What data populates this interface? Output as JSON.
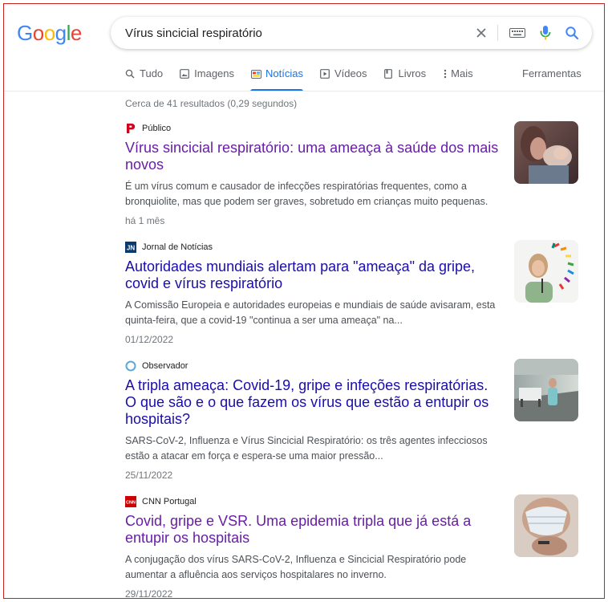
{
  "logo": {
    "letters": [
      "G",
      "o",
      "o",
      "g",
      "l",
      "e"
    ]
  },
  "search": {
    "query": "Vírus sincicial respiratório"
  },
  "tabs": [
    {
      "label": "Tudo",
      "icon": "search-icon"
    },
    {
      "label": "Imagens",
      "icon": "image-icon"
    },
    {
      "label": "Notícias",
      "icon": "news-icon",
      "active": true
    },
    {
      "label": "Vídeos",
      "icon": "video-icon"
    },
    {
      "label": "Livros",
      "icon": "book-icon"
    },
    {
      "label": "Mais",
      "icon": "more-vert-icon"
    }
  ],
  "tools_label": "Ferramentas",
  "stats": "Cerca de 41 resultados (0,29 segundos)",
  "results": [
    {
      "source": "Público",
      "title": "Vírus sincicial respiratório: uma ameaça à saúde dos mais novos",
      "snippet": "É um vírus comum e causador de infecções respiratórias frequentes, como a bronquiolite, mas que podem ser graves, sobretudo em crianças muito pequenas.",
      "date": "há 1 mês",
      "favicon": "publico-p-icon",
      "visited": true
    },
    {
      "source": "Jornal de Notícias",
      "title": "Autoridades mundiais alertam para \"ameaça\" da gripe, covid e vírus respiratório",
      "snippet": "A Comissão Europeia e autoridades europeias e mundiais de saúde avisaram, esta quinta-feira, que a covid-19 \"continua a ser uma ameaça\" na...",
      "date": "01/12/2022",
      "favicon": "jn-icon",
      "visited": false
    },
    {
      "source": "Observador",
      "title": "A tripla ameaça: Covid-19, gripe e infeções respiratórias. O que são e o que fazem os vírus que estão a entupir os hospitais?",
      "snippet": "SARS-CoV-2, Influenza e Vírus Sincicial Respiratório: os três agentes infecciosos estão a atacar em força e espera-se uma maior pressão...",
      "date": "25/11/2022",
      "favicon": "observador-circle-icon",
      "visited": false
    },
    {
      "source": "CNN Portugal",
      "title": "Covid, gripe e VSR. Uma epidemia tripla que já está a entupir os hospitais",
      "snippet": "A conjugação dos vírus SARS-CoV-2, Influenza e Sincicial Respiratório pode aumentar a afluência aos serviços hospitalares no inverno.",
      "date": "29/11/2022",
      "favicon": "cnn-icon",
      "visited": true
    }
  ],
  "colors": {
    "accent": "#1a73e8",
    "link": "#1a0dab",
    "visited": "#681da8",
    "publico_red": "#d0021b",
    "jn_blue": "#0b3a6e",
    "cnn_red": "#cc0000",
    "frame": "#c5221f"
  }
}
